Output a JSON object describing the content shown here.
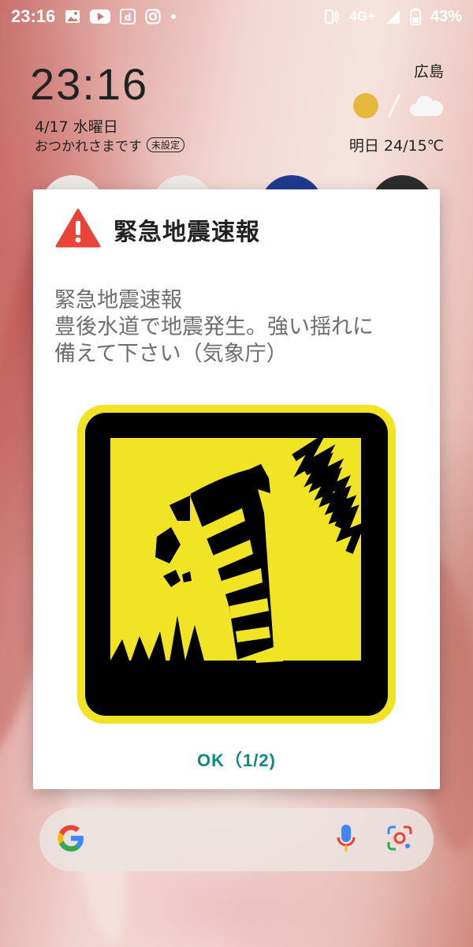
{
  "status_bar": {
    "time": "23:16",
    "network": "4G+",
    "battery": "43%",
    "icons": [
      "gallery-icon",
      "youtube-icon",
      "d-app-icon",
      "instagram-icon",
      "dot-icon",
      "nfc-icon",
      "signal-icon",
      "battery-icon"
    ]
  },
  "clock_widget": {
    "time": "23:16",
    "date": "4/17 水曜日",
    "greeting": "おつかれさまです",
    "greeting_badge": "未設定"
  },
  "weather_widget": {
    "city": "広島",
    "forecast": "明日 24/15℃",
    "icons": [
      "sun-icon",
      "cloud-icon"
    ]
  },
  "dialog": {
    "title": "緊急地震速報",
    "message_lines": {
      "line1": "緊急地震速報",
      "line2": "豊後水道で地震発生。強い揺れに",
      "line3": "備えて下さい（気象庁）"
    },
    "ok_label": "OK（1/2)",
    "colors": {
      "warning_red": "#e8443a",
      "pictogram_yellow": "#f1e425",
      "ok_teal": "#0c8a7b"
    }
  },
  "search_bar": {
    "icons": [
      "google-g-icon",
      "mic-icon",
      "lens-icon"
    ]
  }
}
